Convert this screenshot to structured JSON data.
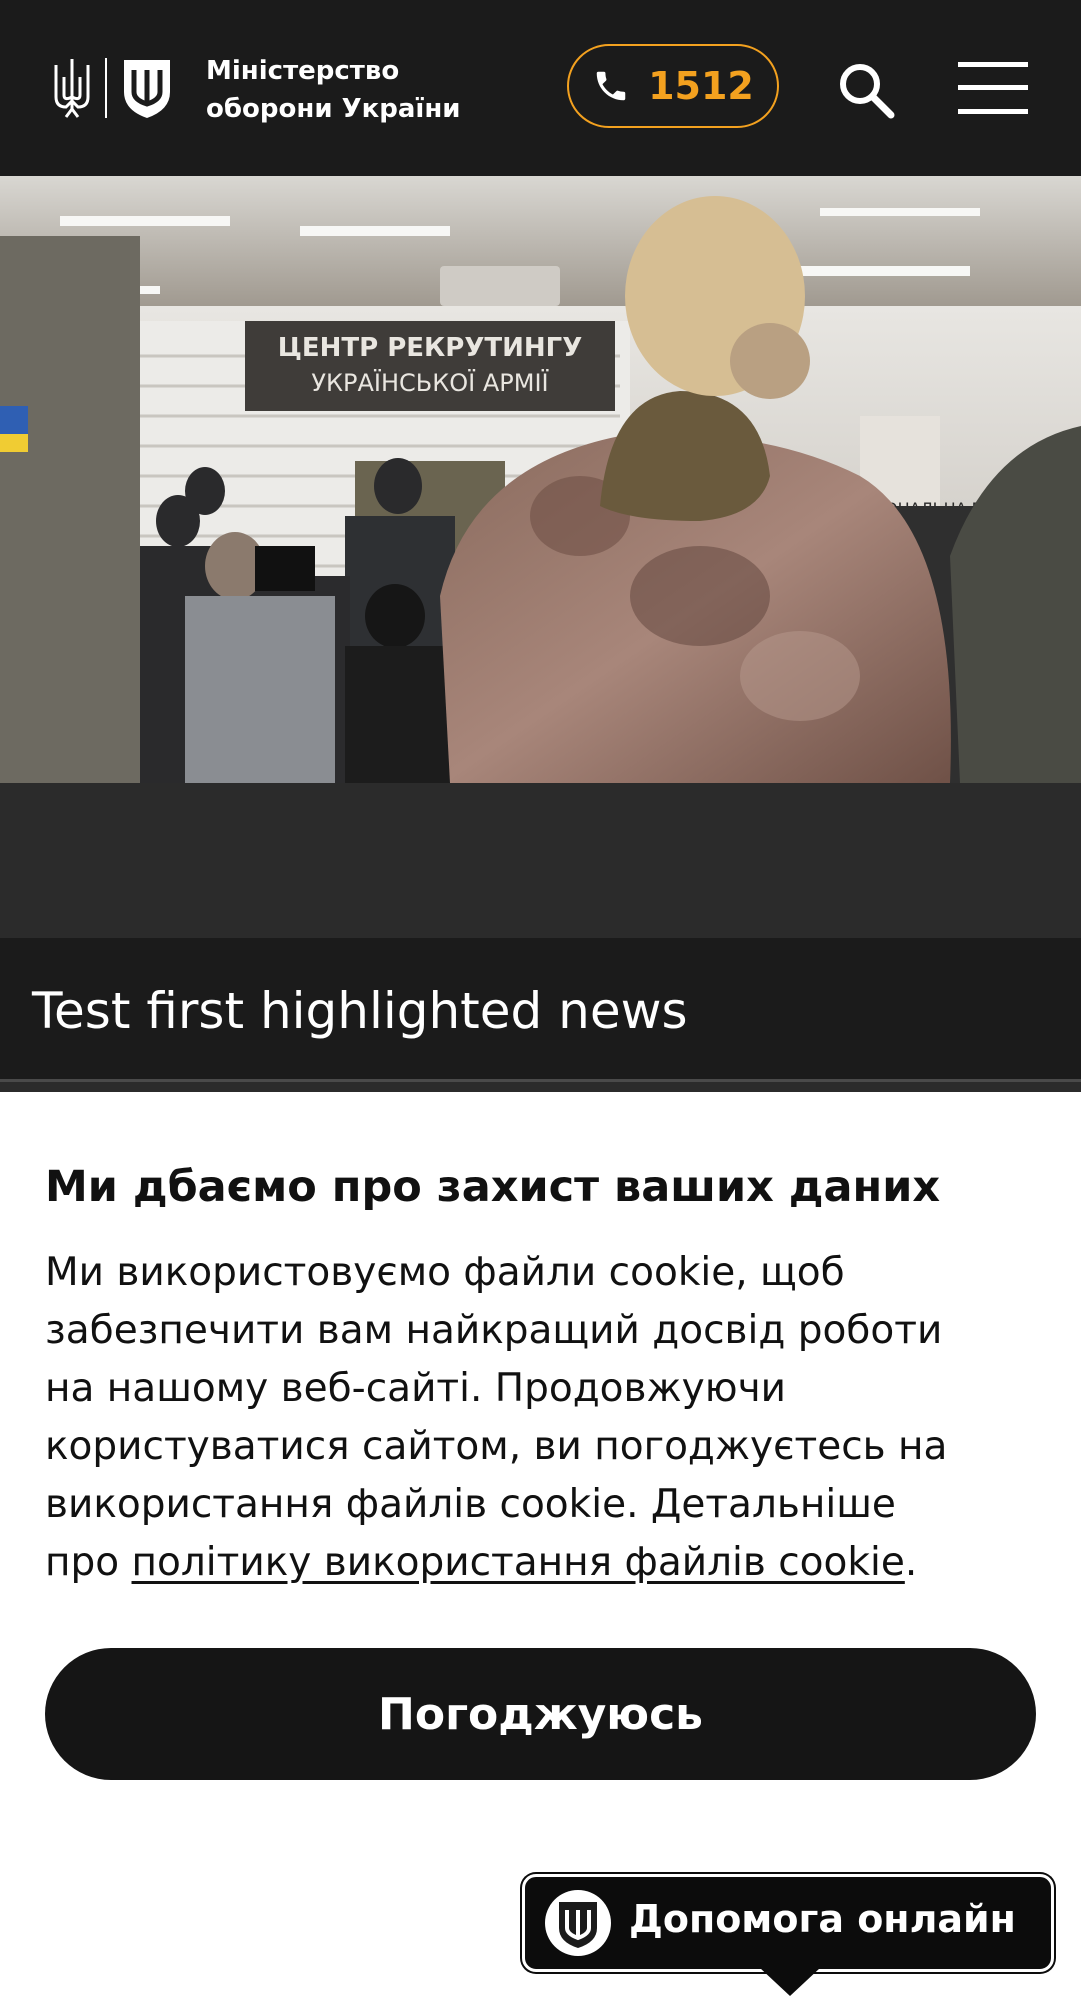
{
  "header": {
    "brand_line1": "Міністерство",
    "brand_line2": "оборони України",
    "hotline_number": "1512",
    "accent_color": "#f3a11f",
    "icons": [
      "trident-icon",
      "shield-icon",
      "phone-icon",
      "search-icon",
      "menu-icon"
    ]
  },
  "hero": {
    "banner_line1": "ЦЕНТР РЕКРУТИНГУ",
    "banner_line2": "УКРАЇНСЬКОЇ АРМІЇ",
    "side_sign": "ОНАЛЬНА ГВА"
  },
  "news": {
    "title": "Test first highlighted news"
  },
  "cookie": {
    "title": "Ми дбаємо про захист ваших даних",
    "text_line1": "Ми використовуємо файли cookie, щоб",
    "text_line2": "забезпечити вам найкращий досвід роботи",
    "text_line3": "на нашому веб-сайті. Продовжуючи",
    "text_line4": "користуватися сайтом, ви погоджуєтесь на",
    "text_line5": "використання файлів cookie. Детальніше",
    "text_line6_prefix": "про ",
    "policy_link": "політику використання файлів cookie",
    "text_line6_suffix": ".",
    "accept_label": "Погоджуюсь"
  },
  "help_widget": {
    "label": "Допомога онлайн"
  }
}
